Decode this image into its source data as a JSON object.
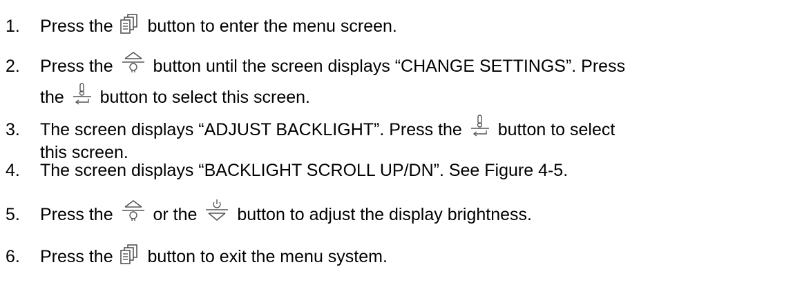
{
  "steps": [
    {
      "number": "1.",
      "before_icon": "Press the ",
      "icon": "menu-icon",
      "after_icon": " button to enter the menu screen."
    },
    {
      "number": "2.",
      "before_icon": "Press the ",
      "icon": "up-light-icon",
      "after_icon": " button until the screen displays “CHANGE SETTINGS”.  Press",
      "line2_before_icon": "the ",
      "line2_icon": "enter-icon",
      "line2_after_icon": " button to select this screen."
    },
    {
      "number": "3.",
      "before_icon": "The screen displays “ADJUST BACKLIGHT”.  Press the ",
      "icon": "enter-icon",
      "after_icon": " button to select",
      "line2_text": "this screen."
    },
    {
      "number": "4.",
      "text": "The screen displays “BACKLIGHT SCROLL UP/DN”.  See Figure 4-5."
    },
    {
      "number": "5.",
      "before_icon": "Press the ",
      "icon": "up-light-icon",
      "middle": " or the ",
      "icon2": "down-power-icon",
      "after_icon": " button to adjust the display brightness."
    },
    {
      "number": "6.",
      "before_icon": "Press the ",
      "icon": "menu-icon",
      "after_icon": " button to exit the menu system."
    }
  ]
}
